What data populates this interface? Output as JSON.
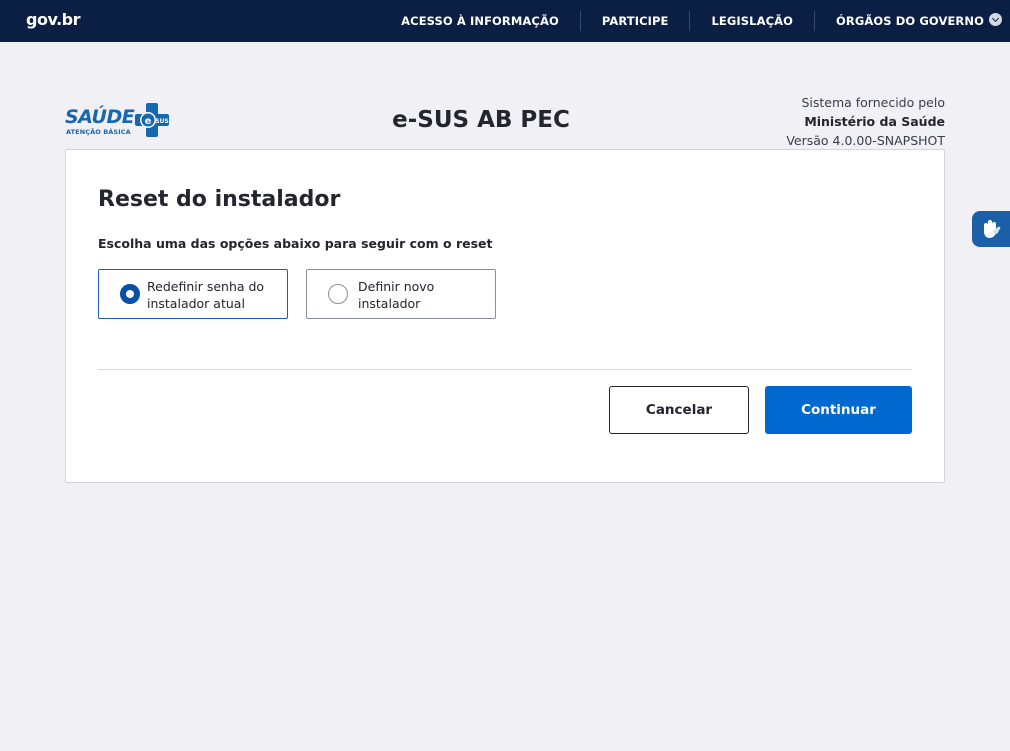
{
  "topbar": {
    "logo": "gov.br",
    "nav": [
      "ACESSO À INFORMAÇÃO",
      "PARTICIPE",
      "LEGISLAÇÃO",
      "ÓRGÃOS DO GOVERNO"
    ]
  },
  "header": {
    "brand": {
      "name": "SAÚDE",
      "sub": "ATENÇÃO BÁSICA",
      "badge": "e SUS"
    },
    "app_title": "e-SUS AB PEC",
    "system": {
      "line1": "Sistema fornecido pelo",
      "line2": "Ministério da Saúde",
      "line3": "Versão 4.0.00-SNAPSHOT"
    }
  },
  "card": {
    "title": "Reset do instalador",
    "instruction": "Escolha uma das opções abaixo para seguir com o reset",
    "options": [
      {
        "label": "Redefinir senha do instalador atual",
        "selected": true
      },
      {
        "label": "Definir novo instalador",
        "selected": false
      }
    ],
    "cancel_label": "Cancelar",
    "continue_label": "Continuar"
  },
  "icons": {
    "gov_chevron": "chevron-down-icon",
    "accessibility": "sign-language-icon"
  },
  "colors": {
    "topbar_bg": "#0b1e44",
    "primary": "#0069d0",
    "brand_blue": "#1666b0",
    "page_bg": "#f0f0f5"
  }
}
